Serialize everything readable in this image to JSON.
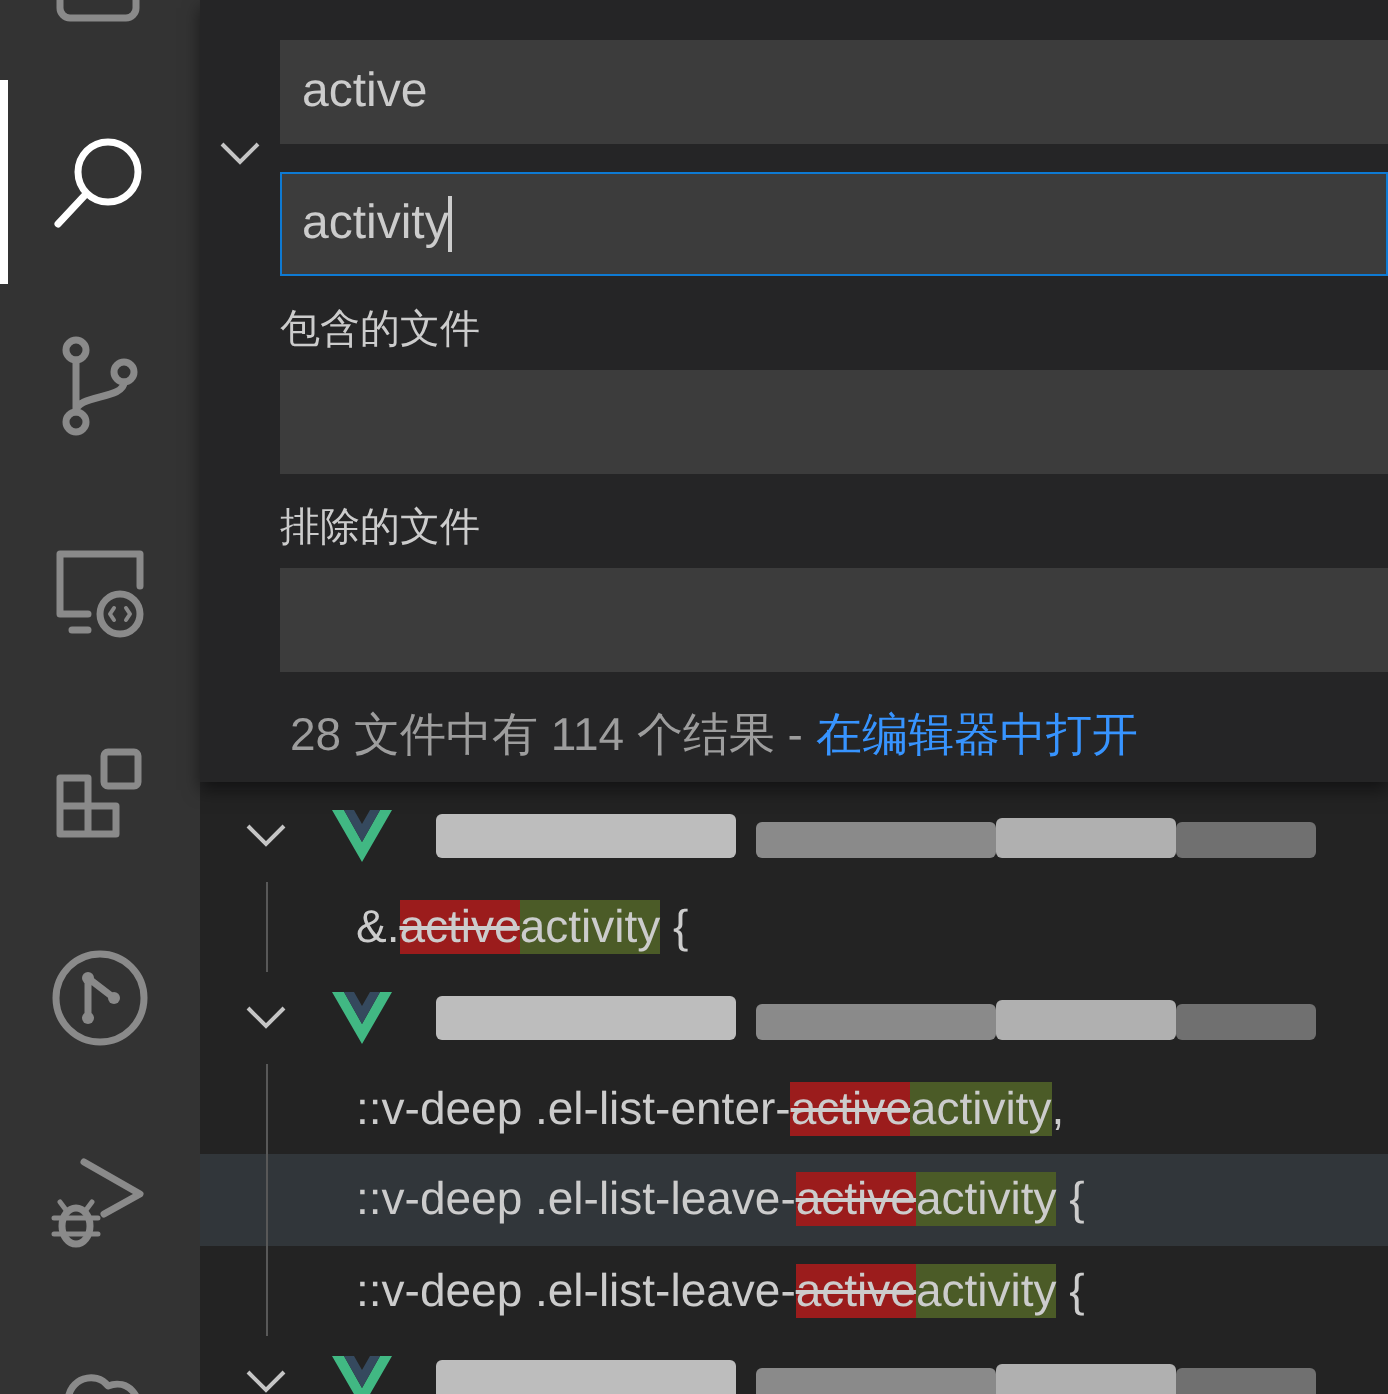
{
  "activity_bar": [
    {
      "kind": "files",
      "selected": false
    },
    {
      "kind": "search",
      "selected": true
    },
    {
      "kind": "source-control",
      "selected": false
    },
    {
      "kind": "remote",
      "selected": false
    },
    {
      "kind": "extensions",
      "selected": false
    },
    {
      "kind": "git-graph",
      "selected": false
    },
    {
      "kind": "debug",
      "selected": false
    },
    {
      "kind": "cloud",
      "selected": false
    }
  ],
  "search": {
    "expanded": true,
    "fields": [
      {
        "value": "active",
        "focused": false
      },
      {
        "value": "activity",
        "focused": true
      }
    ],
    "include": {
      "label": "包含的文件"
    },
    "exclude": {
      "label": "排除的文件"
    },
    "summary": "28 文件中有 114 个结果 - ",
    "open_in_editor": "在编辑器中打开"
  },
  "results": [
    {
      "kind": "file",
      "expanded": true,
      "hovered": false
    },
    {
      "kind": "match",
      "prefix": "&.",
      "removed": "active",
      "added": "activity",
      "suffix": " {",
      "hovered": false
    },
    {
      "kind": "file",
      "expanded": true,
      "hovered": false
    },
    {
      "kind": "match",
      "prefix": "::v-deep .el-list-enter-",
      "removed": "active",
      "added": "activity",
      "suffix": ",",
      "hovered": false
    },
    {
      "kind": "match",
      "prefix": "::v-deep .el-list-leave-",
      "removed": "active",
      "added": "activity",
      "suffix": " {",
      "hovered": true
    },
    {
      "kind": "match",
      "prefix": "::v-deep .el-list-leave-",
      "removed": "active",
      "added": "activity",
      "suffix": " {",
      "hovered": false
    },
    {
      "kind": "file",
      "expanded": true,
      "hovered": false
    }
  ]
}
